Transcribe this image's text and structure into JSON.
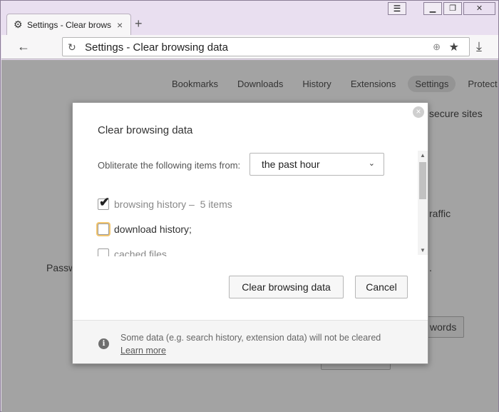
{
  "browser": {
    "tab_title": "Settings - Clear browsing data",
    "url": "Settings - Clear browsing data",
    "new_tab_symbol": "+",
    "icons": [
      "gear-icon",
      "close-icon",
      "menu-icon",
      "minimize-icon",
      "restore-icon",
      "close-window-icon",
      "back-icon",
      "reload-icon",
      "globe-icon",
      "star-icon",
      "download-icon"
    ]
  },
  "settings_nav": {
    "items": [
      "Bookmarks",
      "Downloads",
      "History",
      "Extensions",
      "Settings",
      "Protect"
    ],
    "active": "Settings"
  },
  "background": {
    "secure_sites": "secure sites",
    "traffic": "raffic",
    "passwords_label": "Passw",
    "passwords_button": "words",
    "dot": "."
  },
  "dialog": {
    "title": "Clear browsing data",
    "period_label": "Obliterate the following items from:",
    "period_value": "the past hour",
    "items": [
      {
        "label": "browsing history",
        "suffix": " –  5 items",
        "checked": true
      },
      {
        "label": "download history;",
        "checked": false,
        "focused": true
      },
      {
        "label": "cached files",
        "checked": false
      }
    ],
    "clear_button": "Clear browsing data",
    "cancel_button": "Cancel",
    "footer_text": "Some data (e.g. search history, extension data) will not be cleared",
    "footer_link": "Learn more"
  }
}
